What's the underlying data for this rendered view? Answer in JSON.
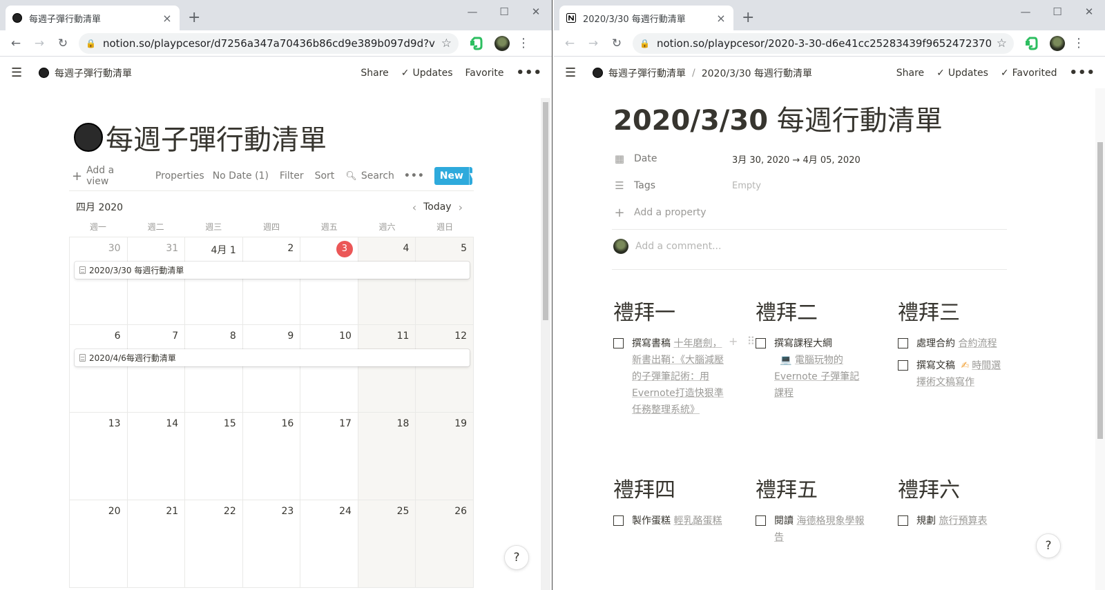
{
  "left": {
    "tab": {
      "title": "每週子彈行動清單",
      "close": "×"
    },
    "new_tab": "+",
    "window_controls": {
      "minimize": "—",
      "maximize": "☐",
      "close": "✕"
    },
    "nav": {
      "back": "←",
      "forward": "→",
      "reload": "↻"
    },
    "url": "notion.so/playpcesor/d7256a347a70436b86cd9e389b097d9d?v=8d...",
    "header": {
      "breadcrumb": "每週子彈行動清單",
      "share": "Share",
      "updates": "Updates",
      "favorite": "Favorite",
      "more": "•••"
    },
    "page_title": "每週子彈行動清單",
    "view": {
      "add_view": "Add a view",
      "properties": "Properties",
      "no_date": "No Date (1)",
      "filter": "Filter",
      "sort": "Sort",
      "search": "Search",
      "more": "•••",
      "new": "New"
    },
    "calendar": {
      "month": "四月 2020",
      "today": "Today",
      "weekdays": [
        "週一",
        "週二",
        "週三",
        "週四",
        "週五",
        "週六",
        "週日"
      ],
      "weeks": [
        [
          "30",
          "31",
          "4月 1",
          "2",
          "3",
          "4",
          "5"
        ],
        [
          "6",
          "7",
          "8",
          "9",
          "10",
          "11",
          "12"
        ],
        [
          "13",
          "14",
          "15",
          "16",
          "17",
          "18",
          "19"
        ],
        [
          "20",
          "21",
          "22",
          "23",
          "24",
          "25",
          "26"
        ]
      ],
      "today_day": "3",
      "events": [
        "2020/3/30 每週行動清單",
        "2020/4/6每週行動清單"
      ]
    },
    "help": "?"
  },
  "right": {
    "tab": {
      "title": "2020/3/30 每週行動清單",
      "close": "×"
    },
    "new_tab": "+",
    "window_controls": {
      "minimize": "—",
      "maximize": "☐",
      "close": "✕"
    },
    "nav": {
      "back": "←",
      "forward": "→",
      "reload": "↻"
    },
    "url": "notion.so/playpcesor/2020-3-30-d6e41cc25283439f9652472370ac0...",
    "header": {
      "breadcrumb_parent": "每週子彈行動清單",
      "breadcrumb_sep": "/",
      "breadcrumb_current": "2020/3/30 每週行動清單",
      "share": "Share",
      "updates": "Updates",
      "favorited": "Favorited",
      "more": "•••"
    },
    "page_title_num": "2020/3/30",
    "page_title_text": "每週行動清單",
    "props": {
      "date_label": "Date",
      "date_value": "3月 30, 2020 → 4月 05, 2020",
      "tags_label": "Tags",
      "tags_value": "Empty",
      "add_property": "Add a property"
    },
    "comment_placeholder": "Add a comment...",
    "days": {
      "mon": {
        "title": "禮拜一",
        "t1_text": "撰寫書稿 ",
        "t1_link": "十年磨劍，新書出鞘：《大腦減壓的子彈筆記術：用Evernote打造快狠準任務整理系統》"
      },
      "tue": {
        "title": "禮拜二",
        "t1_text": "撰寫課程大綱 ",
        "t1_emoji": "💻",
        "t1_link": "電腦玩物的 Evernote 子彈筆記課程"
      },
      "wed": {
        "title": "禮拜三",
        "t1_text": "處理合約 ",
        "t1_link": "合約流程",
        "t2_text": "撰寫文稿 ",
        "t2_emoji": "✍",
        "t2_link": "時間選擇術文稿寫作"
      },
      "thu": {
        "title": "禮拜四",
        "t1_text": "製作蛋糕 ",
        "t1_link": "輕乳酪蛋糕"
      },
      "fri": {
        "title": "禮拜五",
        "t1_text": "閱讀 ",
        "t1_link": "海德格現象學報告"
      },
      "sat": {
        "title": "禮拜六",
        "t1_text": "規劃 ",
        "t1_link": "旅行預算表"
      }
    },
    "help": "?"
  },
  "colors": {
    "accent_blue": "#2eaadc",
    "today_red": "#eb5757",
    "weekend_bg": "#f7f6f3",
    "evernote_green": "#2dbe60"
  }
}
